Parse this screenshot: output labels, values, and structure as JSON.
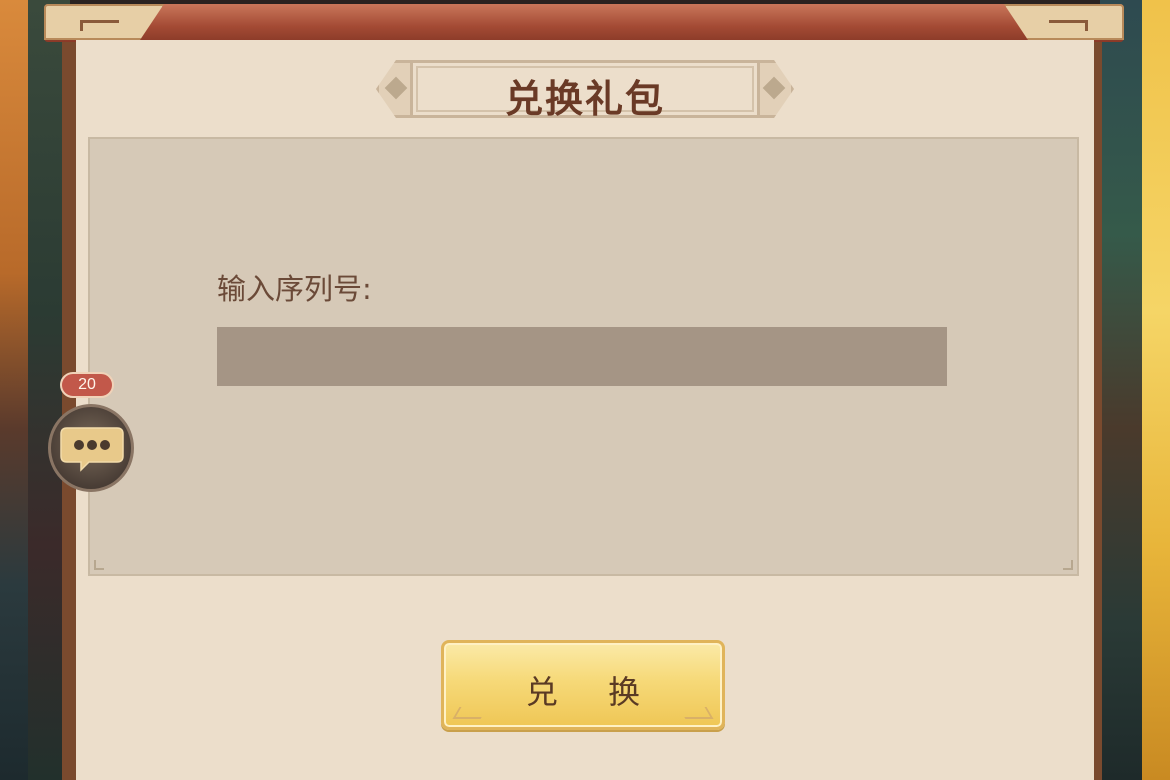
{
  "dialog": {
    "title": "兑换礼包",
    "serial_label": "输入序列号:",
    "serial_value": "",
    "redeem_label": "兑 换"
  },
  "chat": {
    "unread_count": "20",
    "icon": "chat-bubble-icon"
  },
  "colors": {
    "panel_bg": "#ecdecb",
    "content_bg": "#d6c9b7",
    "input_bg": "#a59585",
    "title_text": "#6a3a26",
    "button_gold": "#f6d978",
    "badge_red": "#c2584a"
  }
}
